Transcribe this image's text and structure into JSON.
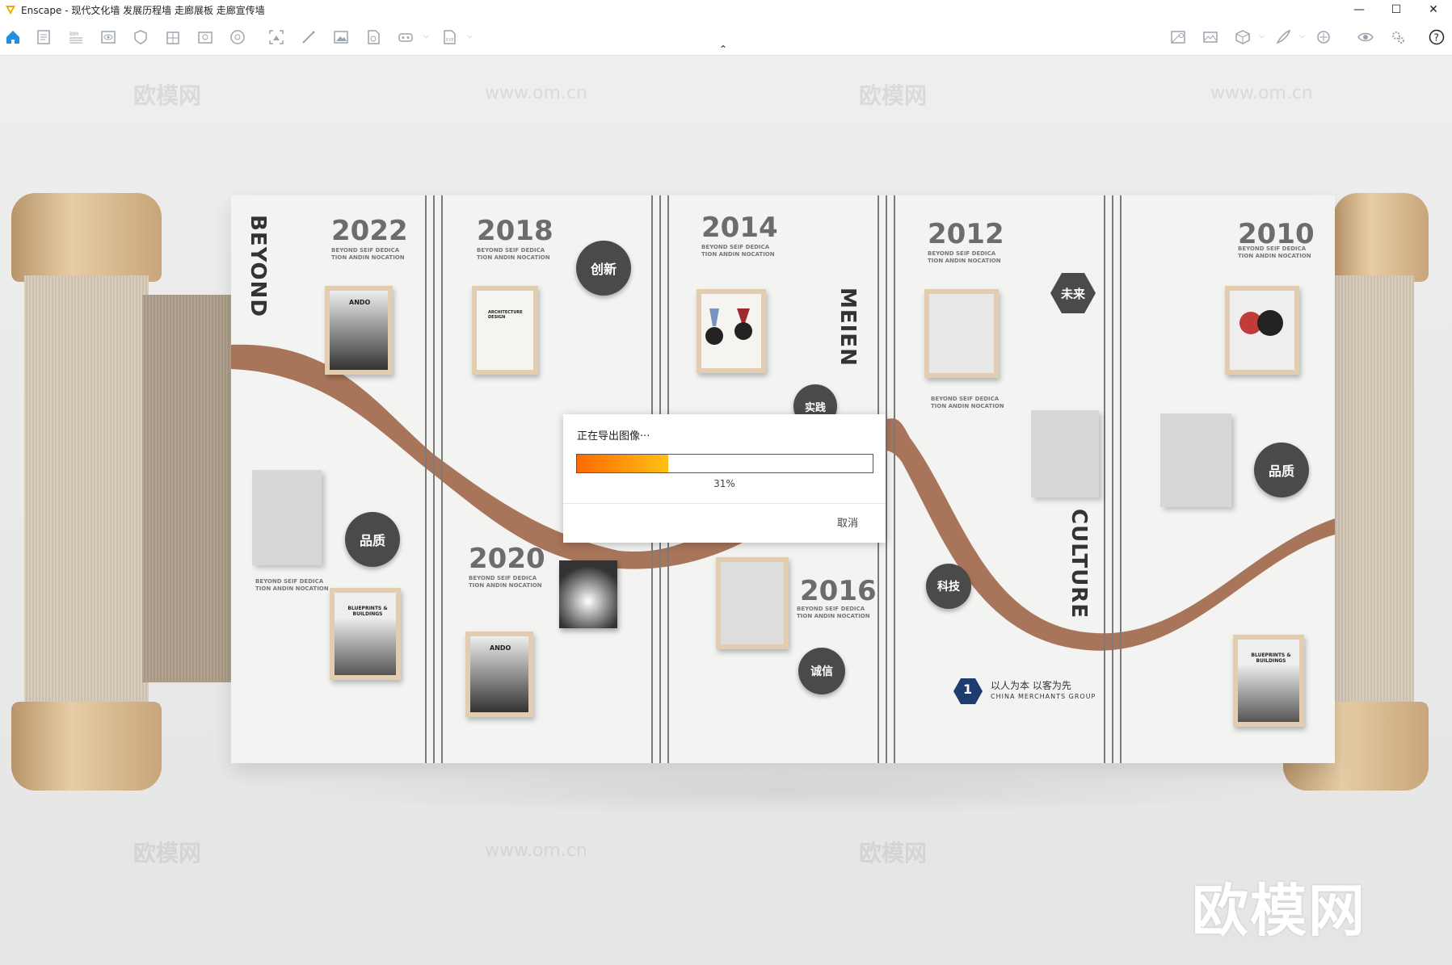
{
  "window": {
    "title": "Enscape - 现代文化墙 发展历程墙 走廊展板 走廊宣传墙",
    "controls": {
      "minimize": "—",
      "maximize": "☐",
      "close": "✕"
    }
  },
  "toolbar": {
    "left_icons": [
      "home-icon",
      "document-icon",
      "bim-icon",
      "eye-box-icon",
      "shield-icon",
      "building-icon",
      "photo-box-icon",
      "sphere-icon",
      "capture-icon",
      "wand-icon",
      "image-icon",
      "file-icon",
      "vr-icon",
      "export-icon"
    ],
    "right_icons": [
      "map-icon",
      "panorama-icon",
      "cube-icon",
      "feather-icon",
      "share-icon",
      "eye-icon",
      "settings-icon",
      "help-icon"
    ],
    "collapse_glyph": "⌃",
    "accent": "#1f8fe6"
  },
  "dialog": {
    "title": "正在导出图像···",
    "progress": 0.31,
    "percent_label": "31%",
    "cancel_label": "取消"
  },
  "scene": {
    "years": [
      "2022",
      "2018",
      "2014",
      "2012",
      "2010",
      "2020",
      "2016"
    ],
    "year_subtitle": "BEYOND SEIF DEDICA TION ANDIN NOCATION",
    "vertical_words": [
      "BEYOND",
      "MEIEN",
      "CULTURE"
    ],
    "badges": [
      "创新",
      "实践",
      "未来",
      "品质",
      "品质",
      "科技",
      "诚信"
    ],
    "frame_labels": [
      "ANDO",
      "ARCHITECTURE DESIGN",
      "BLUEPRINTS & BUILDINGS",
      "ANDO",
      "BLUEPRINTS & BUILDINGS"
    ],
    "slogan": "以人为本 以客为先",
    "slogan_sub": "CHINA MERCHANTS GROUP",
    "slogan_num": "1",
    "watermark_text": "欧模网",
    "watermark_url": "www.om.cn",
    "brand_watermark": "欧模网",
    "colors": {
      "wall": "#f3f3f2",
      "ribbon": "#a9755a",
      "badge": "#4a4a4a",
      "frame": "#e2cdb0"
    }
  }
}
